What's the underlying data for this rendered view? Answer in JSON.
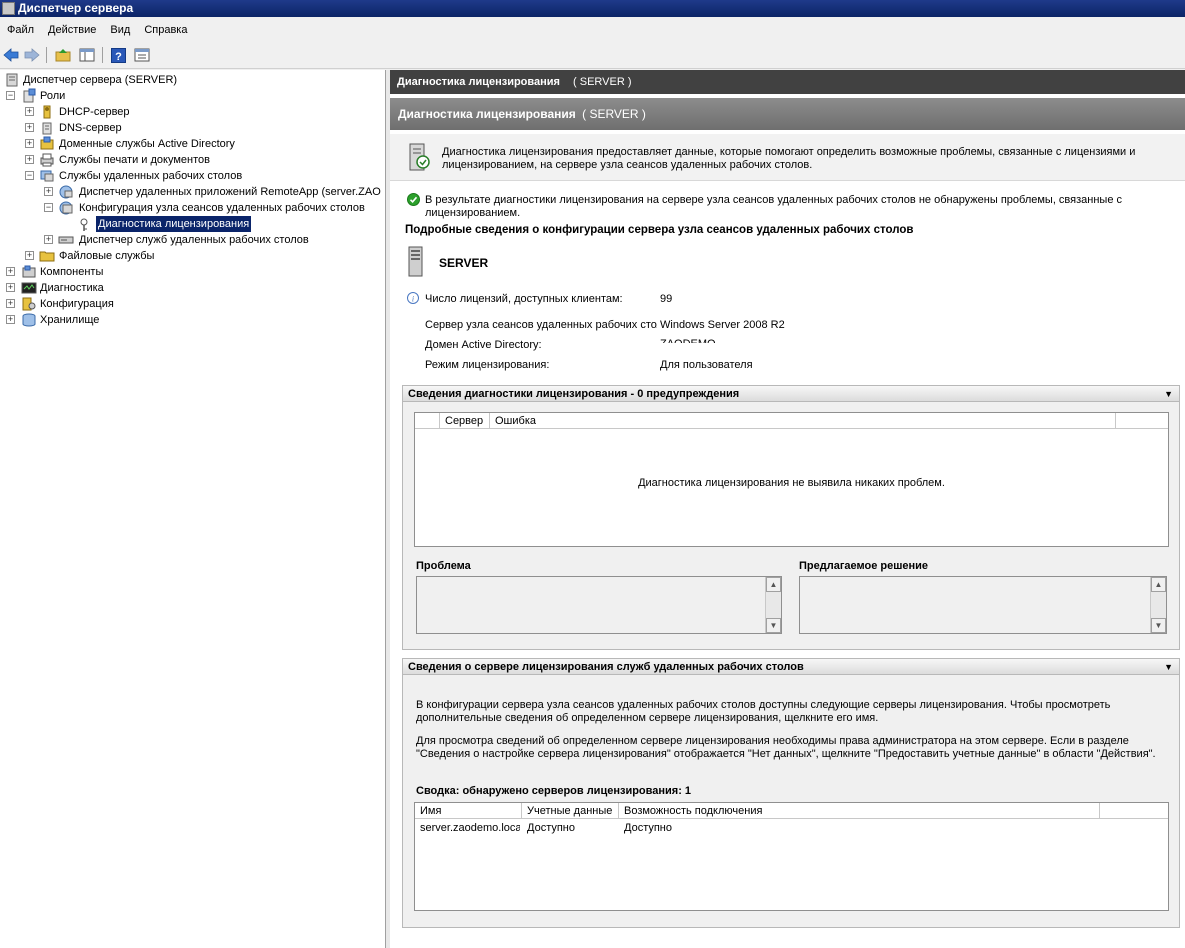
{
  "window": {
    "title": "Диспетчер сервера"
  },
  "menu": [
    "Файл",
    "Действие",
    "Вид",
    "Справка"
  ],
  "toolbar": {
    "back_icon": "back-arrow-icon",
    "forward_icon": "forward-arrow-icon",
    "up_icon": "up-folder-icon",
    "show_hide_icon": "show-hide-console-tree-icon",
    "help_icon": "help-icon",
    "properties_icon": "properties-icon",
    "accent": "#3a7bd5"
  },
  "tree": {
    "root": "Диспетчер сервера (SERVER)",
    "roles": "Роли",
    "dhcp": "DHCP-сервер",
    "dns": "DNS-сервер",
    "ad": "Доменные службы Active Directory",
    "print": "Службы печати и документов",
    "rds": "Службы удаленных рабочих столов",
    "remoteapp": "Диспетчер удаленных приложений RemoteApp (server.ZAO",
    "rdsh_config": "Конфигурация узла сеансов удаленных рабочих столов",
    "licensing_diag": "Диагностика лицензирования",
    "rds_manager": "Диспетчер служб удаленных рабочих столов",
    "file": "Файловые службы",
    "features": "Компоненты",
    "diagnostics": "Диагностика",
    "configuration": "Конфигурация",
    "storage": "Хранилище",
    "selected_color": "#0a246a"
  },
  "header": {
    "title1": "Диагностика лицензирования",
    "server1": "( SERVER )",
    "title2": "Диагностика лицензирования",
    "server2": "( SERVER )"
  },
  "description": "Диагностика лицензирования предоставляет данные, которые помогают определить возможные проблемы, связанные с лицензиями и лицензированием, на сервере узла сеансов удаленных рабочих столов.",
  "result": {
    "message": "В результате диагностики лицензирования на сервере узла сеансов удаленных рабочих столов не обнаружены проблемы, связанные с лицензированием.",
    "status_color": "#2ca02c"
  },
  "details": {
    "heading": "Подробные сведения о конфигурации сервера узла сеансов удаленных рабочих столов",
    "server_name": "SERVER",
    "licenses_label": "Число лицензий, доступных клиентам:",
    "licenses_value": "99",
    "rdsh_label": "Сервер узла сеансов удаленных рабочих стол",
    "rdsh_value": "Windows Server 2008 R2",
    "domain_label": "Домен Active Directory:",
    "domain_value": "ZAODEMO",
    "mode_label": "Режим лицензирования:",
    "mode_value": "Для пользователя"
  },
  "diag_section": {
    "title": "Сведения диагностики лицензирования - 0 предупреждения",
    "columns": [
      "Сервер",
      "Ошибка"
    ],
    "empty_message": "Диагностика лицензирования не выявила никаких проблем.",
    "problem_label": "Проблема",
    "solution_label": "Предлагаемое решение"
  },
  "lic_section": {
    "title": "Сведения о сервере лицензирования служб удаленных рабочих столов",
    "para1": "В конфигурации сервера узла сеансов удаленных рабочих столов доступны следующие серверы лицензирования. Чтобы просмотреть дополнительные сведения об определенном сервере лицензирования, щелкните его имя.",
    "para2": "Для просмотра сведений об определенном сервере лицензирования необходимы права администратора на этом сервере. Если в разделе \"Сведения о настройке сервера лицензирования\" отображается \"Нет данных\", щелкните \"Предоставить учетные данные\" в области \"Действия\".",
    "summary": "Сводка: обнаружено серверов лицензирования: 1",
    "columns": [
      "Имя",
      "Учетные данные",
      "Возможность подключения"
    ],
    "rows": [
      {
        "name": "server.zaodemo.local",
        "credentials": "Доступно",
        "connectivity": "Доступно"
      }
    ]
  }
}
